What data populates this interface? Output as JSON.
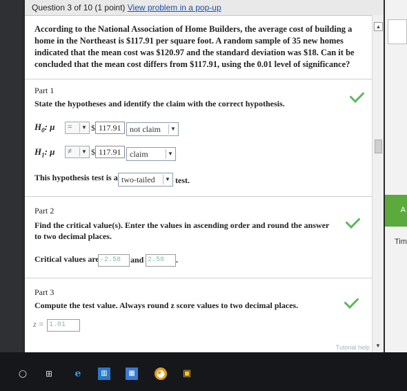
{
  "header": {
    "question": "Question 3 of 10 (1 point)",
    "popup_link": "View problem in a pop-up"
  },
  "problem_text": "According to the National Association of Home Builders, the average cost of building a home in the Northeast is $117.91 per square foot. A random sample of 35 new homes indicated that the mean cost was $120.97 and the standard deviation was $18. Can it be concluded that the mean cost differs from $117.91, using the 0.01 level of significance?",
  "part1": {
    "title": "Part 1",
    "instruction": "State the hypotheses and identify the claim with the correct hypothesis.",
    "h0": {
      "label": "H",
      "sub": "0",
      "suffix": ": μ",
      "relation": "=",
      "value": "117.91",
      "claim": "not claim"
    },
    "h1": {
      "label": "H",
      "sub": "1",
      "suffix": ": μ",
      "relation": "≠",
      "value": "117.91",
      "claim": "claim"
    },
    "dollar": "$",
    "test_prefix": "This hypothesis test is a",
    "test_type": "two-tailed",
    "test_suffix": "test."
  },
  "part2": {
    "title": "Part 2",
    "instruction": "Find the critical value(s). Enter the values in ascending order and round the answer to two decimal places.",
    "prefix": "Critical values are",
    "value1": "-2.58",
    "and": "and",
    "value2": "2.58",
    "end": "."
  },
  "part3": {
    "title": "Part 3",
    "instruction": "Compute the test value. Always round z score values to two decimal places.",
    "z_label": "z =",
    "z_value": "1.01"
  },
  "tutorial_label": "Tutorial help",
  "right_panel": {
    "green_label": "A",
    "tim_label": "Tim"
  },
  "colors": {
    "check": "#5cb85c",
    "link": "#1a4fa8",
    "taskbar": "#15171a"
  }
}
